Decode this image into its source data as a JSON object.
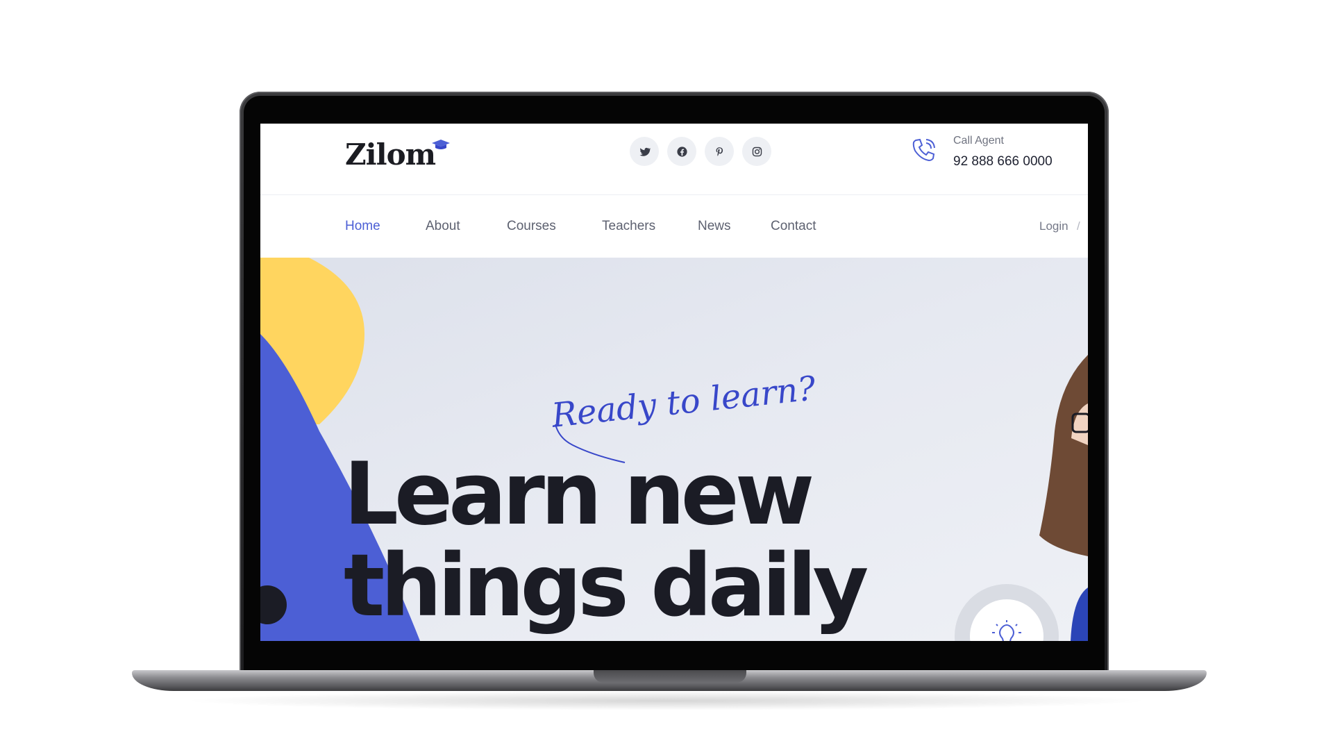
{
  "brand": {
    "name": "Zilom",
    "accent": "#4c5fd5",
    "yellow": "#ffd55f",
    "dark": "#1b1c25"
  },
  "header": {
    "social": [
      "twitter-icon",
      "facebook-icon",
      "pinterest-icon",
      "instagram-icon"
    ],
    "call_label": "Call Agent",
    "call_number": "92 888 666 0000"
  },
  "nav": {
    "items": [
      {
        "label": "Home",
        "active": true
      },
      {
        "label": "About",
        "active": false
      },
      {
        "label": "Courses",
        "active": false
      },
      {
        "label": "Teachers",
        "active": false
      },
      {
        "label": "News",
        "active": false
      },
      {
        "label": "Contact",
        "active": false
      }
    ],
    "login": "Login",
    "separator": "/"
  },
  "hero": {
    "tagline": "Ready to learn?",
    "headline_line1": "Learn new",
    "headline_line2": "things daily",
    "badge_icon": "lightbulb-icon"
  }
}
